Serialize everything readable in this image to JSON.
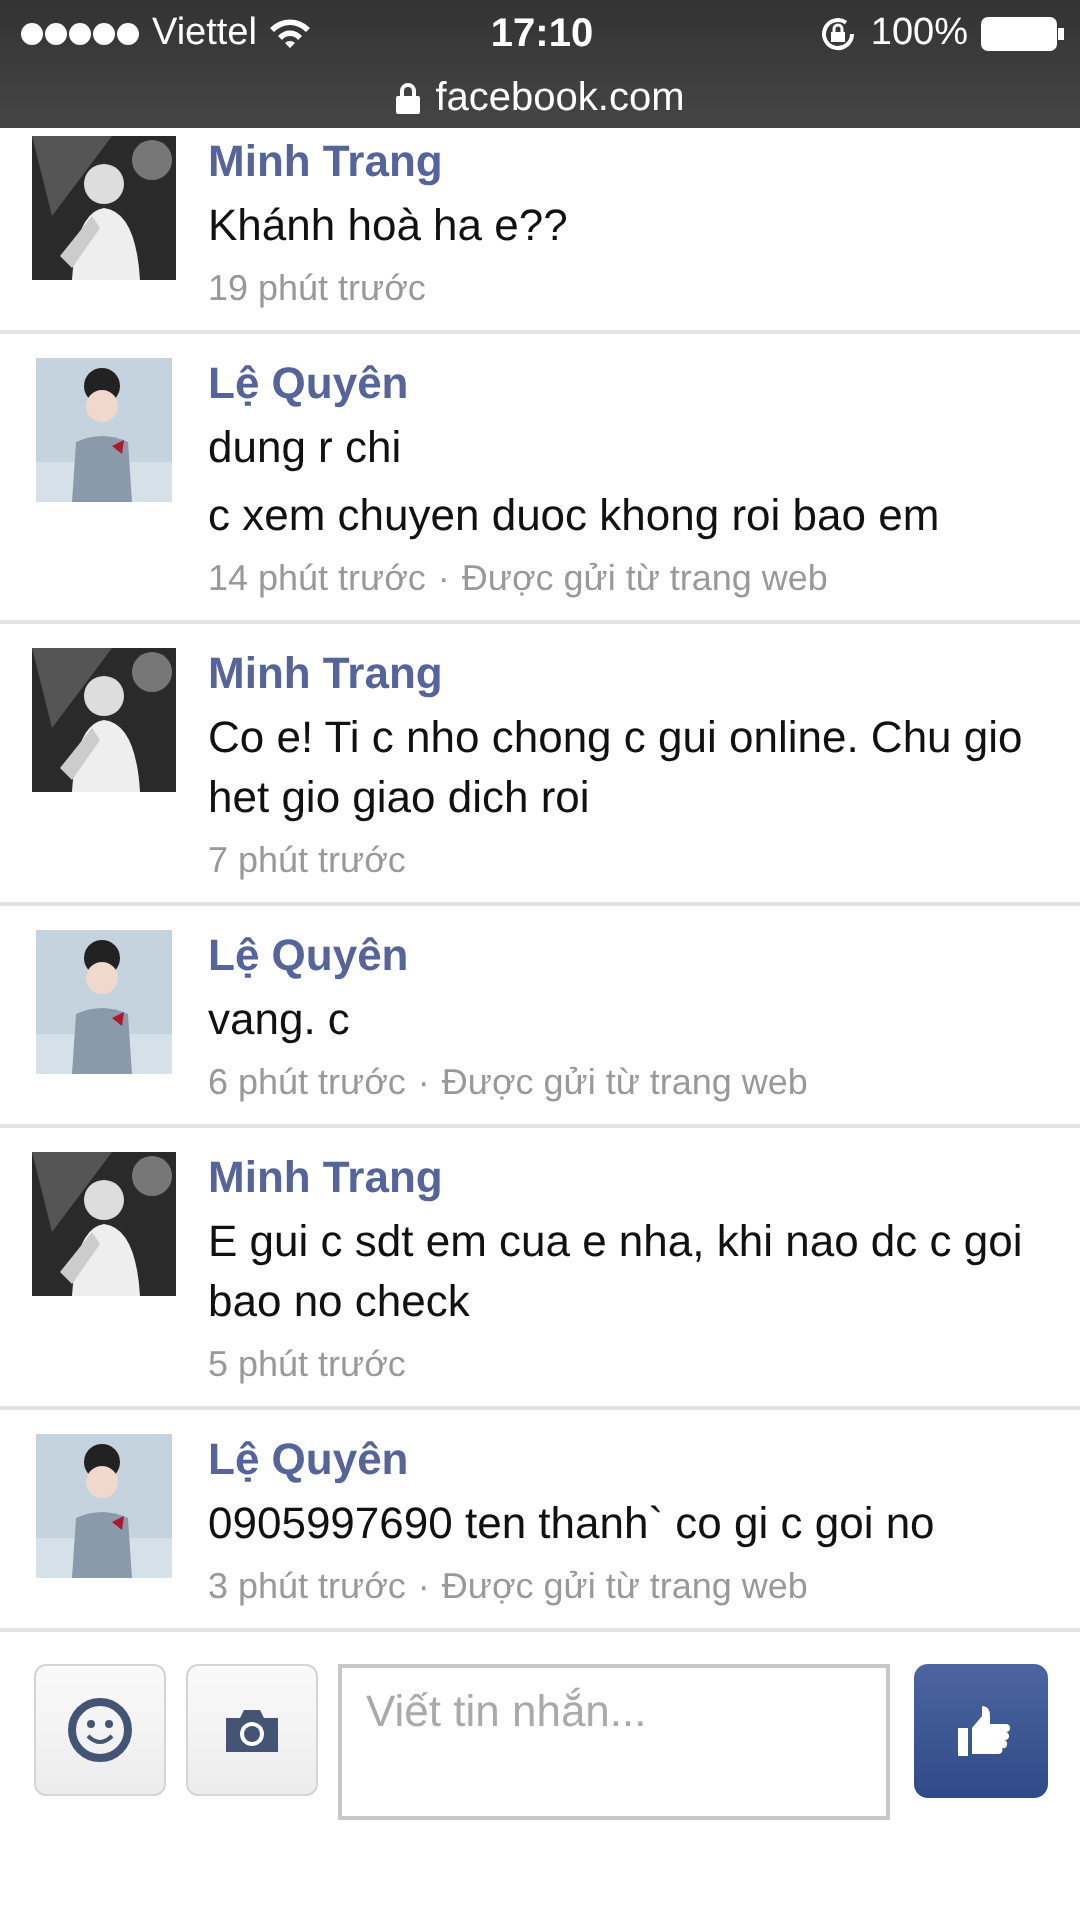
{
  "status_bar": {
    "carrier": "Viettel",
    "time": "17:10",
    "battery": "100%"
  },
  "address_bar": {
    "url": "facebook.com"
  },
  "messages": [
    {
      "sender": "Minh Trang",
      "lines": [
        "Khánh hoà ha e??"
      ],
      "time": "19 phút trước"
    },
    {
      "sender": "Lệ Quyên",
      "lines": [
        "dung r chi",
        "c xem chuyen duoc khong roi bao em"
      ],
      "time": "14 phút trước",
      "separator": "·",
      "via": "Được gửi từ trang web"
    },
    {
      "sender": "Minh Trang",
      "lines": [
        "Co e! Ti c nho chong c gui online. Chu gio het gio giao dich roi"
      ],
      "time": "7 phút trước"
    },
    {
      "sender": "Lệ Quyên",
      "lines": [
        "vang. c"
      ],
      "time": "6 phút trước",
      "separator": "·",
      "via": "Được gửi từ trang web"
    },
    {
      "sender": "Minh Trang",
      "lines": [
        "E gui c sdt em cua e nha, khi nao dc c goi bao no check"
      ],
      "time": "5 phút trước"
    },
    {
      "sender": "Lệ Quyên",
      "lines": [
        "0905997690 ten thanh` co gi c goi no"
      ],
      "time": "3 phút trước",
      "separator": "·",
      "via": "Được gửi từ trang web"
    }
  ],
  "composer": {
    "placeholder": "Viết tin nhắn..."
  }
}
